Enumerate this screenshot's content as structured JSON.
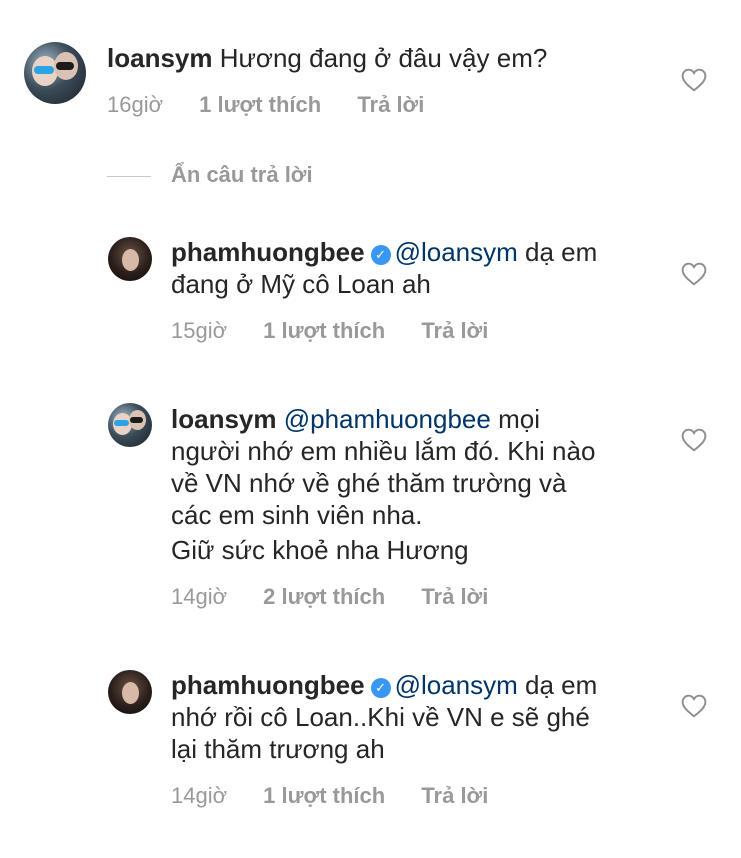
{
  "comments": [
    {
      "username": "loansym",
      "text": "Hương đang ở đâu vậy em?",
      "time": "16giờ",
      "likes": "1 lượt thích",
      "reply": "Trả lời"
    },
    {
      "username": "phamhuongbee",
      "mention": "@loansym",
      "text_line1": "dạ em",
      "text_line2": "đang ở Mỹ cô Loan ah",
      "time": "15giờ",
      "likes": "1 lượt thích",
      "reply": "Trả lời"
    },
    {
      "username": "loansym",
      "mention": "@phamhuongbee",
      "text_line1": "mọi",
      "text_line2": "người nhớ em nhiều lắm đó. Khi nào",
      "text_line3": "về VN nhớ về ghé thăm trường và",
      "text_line4": "các em sinh viên nha.",
      "text_line5": "Giữ sức khoẻ nha Hương",
      "time": "14giờ",
      "likes": "2 lượt thích",
      "reply": "Trả lời"
    },
    {
      "username": "phamhuongbee",
      "mention": "@loansym",
      "text_line1": "dạ em",
      "text_line2": "nhớ rồi cô Loan..Khi về VN e sẽ ghé",
      "text_line3": "lại thăm trương ah",
      "time": "14giờ",
      "likes": "1 lượt thích",
      "reply": "Trả lời"
    }
  ],
  "hide_replies": "Ẩn câu trả lời",
  "icons": {
    "like": "heart-outline-icon",
    "verified": "verified-badge-icon"
  },
  "colors": {
    "mention": "#003569",
    "verified": "#3897f0",
    "meta": "#999999"
  }
}
